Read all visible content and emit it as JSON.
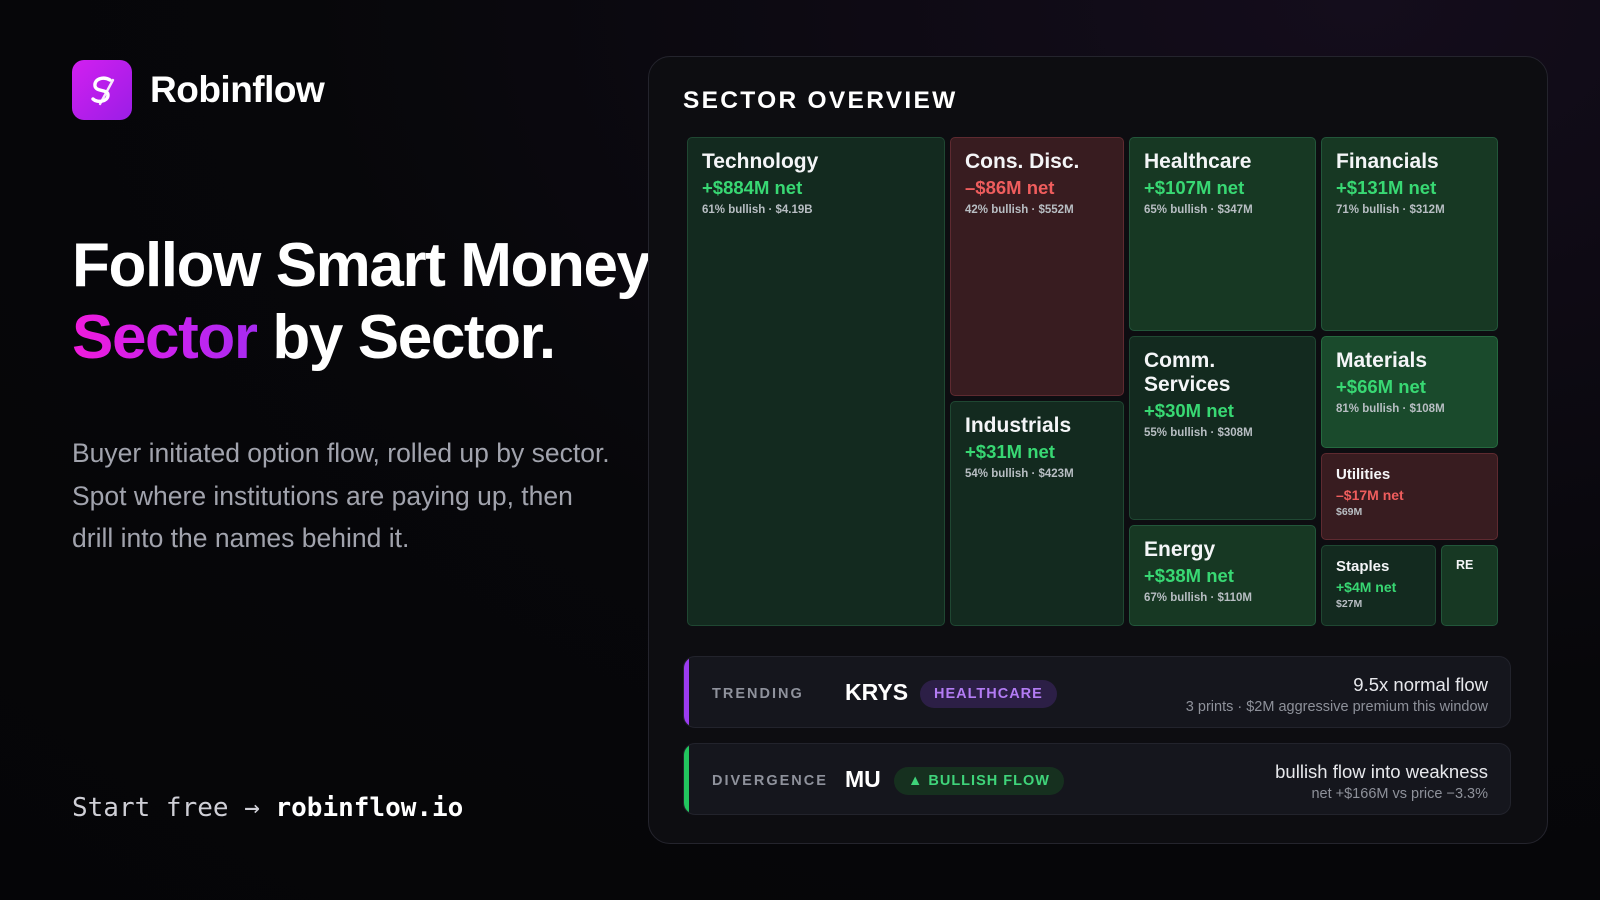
{
  "brand": {
    "name": "Robinflow",
    "logo_icon": "flow-s-icon"
  },
  "headline": {
    "line1": "Follow Smart Money",
    "accent": "Sector",
    "rest": " by Sector."
  },
  "description": "Buyer initiated option flow, rolled up by sector. Spot where institutions are paying up, then drill into the names behind it.",
  "cta": {
    "prefix": "Start free → ",
    "url": "robinflow.io"
  },
  "colors": {
    "accent": "#d21ff0",
    "positive": "#38d873",
    "negative": "#ef5d5d",
    "trending_bar": "#9b3bf0",
    "divergence_bar": "#22c55e"
  },
  "panel": {
    "title": "SECTOR OVERVIEW",
    "sectors": [
      {
        "name": "Technology",
        "net": "+$884M net",
        "detail": "61% bullish · $4.19B",
        "sentiment": "positive"
      },
      {
        "name": "Cons. Disc.",
        "net": "–$86M net",
        "detail": "42% bullish · $552M",
        "sentiment": "negative"
      },
      {
        "name": "Industrials",
        "net": "+$31M net",
        "detail": "54% bullish · $423M",
        "sentiment": "positive"
      },
      {
        "name": "Healthcare",
        "net": "+$107M net",
        "detail": "65% bullish · $347M",
        "sentiment": "positive"
      },
      {
        "name": "Comm. Services",
        "net": "+$30M net",
        "detail": "55% bullish · $308M",
        "sentiment": "positive"
      },
      {
        "name": "Energy",
        "net": "+$38M net",
        "detail": "67% bullish · $110M",
        "sentiment": "positive"
      },
      {
        "name": "Financials",
        "net": "+$131M net",
        "detail": "71% bullish · $312M",
        "sentiment": "positive"
      },
      {
        "name": "Materials",
        "net": "+$66M net",
        "detail": "81% bullish · $108M",
        "sentiment": "positive"
      },
      {
        "name": "Utilities",
        "net": "–$17M net",
        "detail": "$69M",
        "sentiment": "negative"
      },
      {
        "name": "Staples",
        "net": "+$4M net",
        "detail": "$27M",
        "sentiment": "positive"
      },
      {
        "name": "RE",
        "net": "",
        "detail": "",
        "sentiment": "positive"
      }
    ],
    "trending": {
      "label": "TRENDING",
      "ticker": "KRYS",
      "badge": "HEALTHCARE",
      "headline": "9.5x normal flow",
      "detail": "3 prints · $2M aggressive premium this window"
    },
    "divergence": {
      "label": "DIVERGENCE",
      "ticker": "MU",
      "badge": "▲ BULLISH FLOW",
      "headline": "bullish flow into weakness",
      "detail": "net +$166M vs price −3.3%"
    }
  }
}
